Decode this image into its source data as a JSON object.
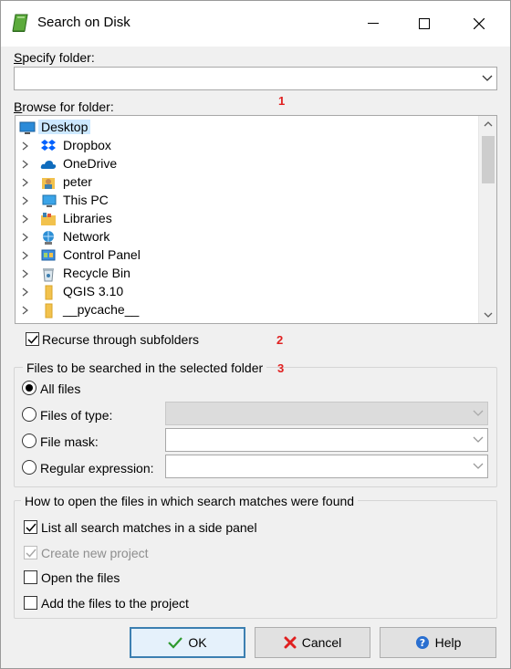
{
  "window": {
    "title": "Search on Disk",
    "app_icon": "green-book-icon",
    "controls": {
      "minimize": "minimize-icon",
      "maximize": "maximize-icon",
      "close": "close-icon"
    }
  },
  "specify_folder": {
    "label_accel": "S",
    "label_rest": "pecify folder:",
    "value": ""
  },
  "browse": {
    "label_accel": "B",
    "label_rest": "rowse for folder:",
    "items": [
      {
        "label": "Desktop",
        "icon": "desktop-icon",
        "selected": true
      },
      {
        "label": "Dropbox",
        "icon": "dropbox-icon"
      },
      {
        "label": "OneDrive",
        "icon": "onedrive-icon"
      },
      {
        "label": "peter",
        "icon": "user-folder-icon"
      },
      {
        "label": "This PC",
        "icon": "this-pc-icon"
      },
      {
        "label": "Libraries",
        "icon": "libraries-icon"
      },
      {
        "label": "Network",
        "icon": "network-icon"
      },
      {
        "label": "Control Panel",
        "icon": "control-panel-icon"
      },
      {
        "label": "Recycle Bin",
        "icon": "recycle-bin-icon"
      },
      {
        "label": "QGIS 3.10",
        "icon": "folder-icon"
      },
      {
        "label": "__pycache__",
        "icon": "folder-icon"
      }
    ]
  },
  "annotations": {
    "one": "1",
    "two": "2",
    "three": "3"
  },
  "recurse": {
    "label": "Recurse through subfolders",
    "checked": true
  },
  "files_group": {
    "title": "Files to be searched in the selected folder",
    "options": {
      "all": "All files",
      "type": "Files of type:",
      "mask": "File mask:",
      "regex": "Regular expression:"
    },
    "selected": "all"
  },
  "open_group": {
    "title": "How to open the files in which search matches were found",
    "list_side_panel": {
      "label": "List all search matches in a side panel",
      "checked": true
    },
    "create_project": {
      "label": "Create new project",
      "checked": true,
      "disabled": true
    },
    "open_files": {
      "label": "Open the files",
      "checked": false
    },
    "add_files": {
      "label": "Add the files to the project",
      "checked": false
    }
  },
  "buttons": {
    "ok": "OK",
    "cancel": "Cancel",
    "help": "Help"
  },
  "colors": {
    "accent": "#3c7fb1",
    "selection": "#cce8ff",
    "annotation": "#e02020"
  }
}
